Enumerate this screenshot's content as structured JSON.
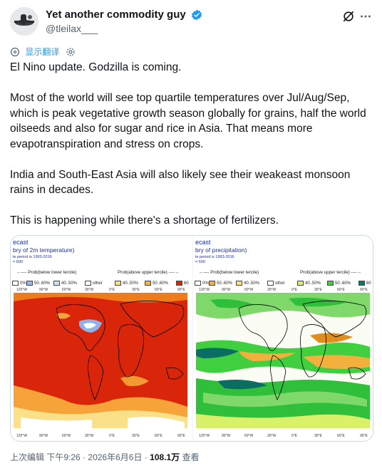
{
  "author": {
    "display_name": "Yet another commodity guy",
    "handle": "@tleilax___"
  },
  "translate": {
    "label": "显示翻译"
  },
  "tweet_paragraphs": [
    "El Nino update. Godzilla is coming.",
    "Most of the world will see top quartile temperatures over Jul/Aug/Sep, which is peak vegetative growth season globally for grains, half the world oilseeds and also for sugar and rice in Asia. That means more evapotranspiration and stress on crops.",
    "India and South-East Asia will also likely see their weakeast monsoon rains in decades.",
    "This is happening while there's a shortage of fertilizers."
  ],
  "media": {
    "left": {
      "title": "ecast",
      "subtitle": "bry of 2m temperature)",
      "period": "te period is 1993-2016",
      "n": "= 600",
      "lower_label": "←---- Prob(below lower tercile)",
      "upper_label": "Prob(above upper tercile) ----→",
      "legend": [
        {
          "label": "0%",
          "color": "#ffffff"
        },
        {
          "label": "50..60%",
          "color": "#9bb7e6"
        },
        {
          "label": "40..50%",
          "color": "#d3e0f3"
        },
        {
          "label": "other",
          "color": "#ffffff"
        },
        {
          "label": "40..50%",
          "color": "#f9e07f"
        },
        {
          "label": "50..60%",
          "color": "#f3b43a"
        },
        {
          "label": "60",
          "color": "#d62a00"
        }
      ]
    },
    "right": {
      "title": "ecast",
      "subtitle": "bry of precipitation)",
      "period": "te period is 1993-2016",
      "n": "= 600",
      "lower_label": "←---- Prob(below lower tercile)",
      "upper_label": "Prob(above upper tercile) ----→",
      "legend": [
        {
          "label": "0%",
          "color": "#ffffff"
        },
        {
          "label": "50..60%",
          "color": "#f2b13c"
        },
        {
          "label": "40..50%",
          "color": "#f9e07f"
        },
        {
          "label": "other",
          "color": "#ffffff"
        },
        {
          "label": "40..50%",
          "color": "#d9f06b"
        },
        {
          "label": "50..60%",
          "color": "#3fcf3f"
        },
        {
          "label": "60",
          "color": "#0a7a66"
        }
      ]
    },
    "lon_labels": [
      "120°W",
      "90°W",
      "60°W",
      "30°W",
      "0°E",
      "30°E",
      "60°E",
      "90°E"
    ],
    "colors": {
      "temp_dominant": "#d9260b",
      "temp_orange": "#f08c1f",
      "temp_cool": "#8fb2e8",
      "precip_dominant": "#2fbf3a",
      "precip_dark": "#0b6c63",
      "precip_dry": "#f2b13c"
    }
  },
  "meta": {
    "edited": "上次编辑",
    "time": "下午9:26",
    "date": "2026年6月6日",
    "views_count": "108.1万",
    "views_label": "查看"
  }
}
